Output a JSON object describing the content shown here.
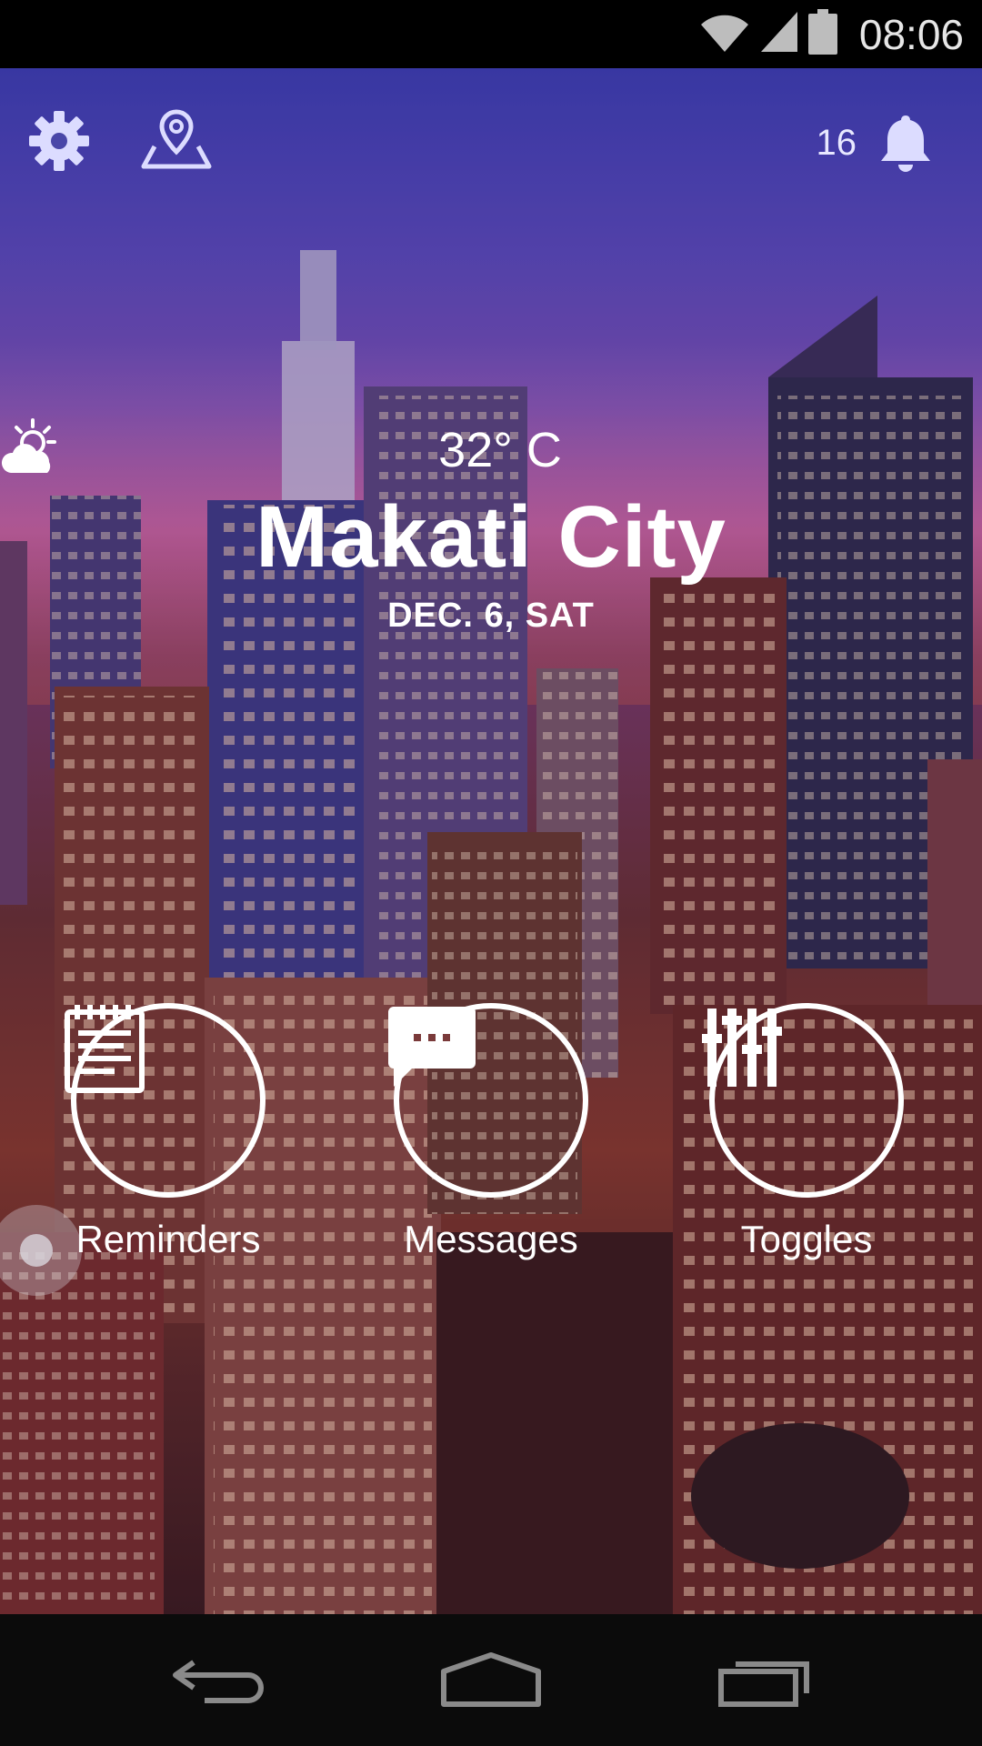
{
  "status_bar": {
    "time": "08:06",
    "icons": [
      "wifi-icon",
      "cell-signal-icon",
      "battery-icon"
    ]
  },
  "top_bar": {
    "settings_icon": "gear-icon",
    "location_icon": "map-pin-icon",
    "notification_count": "16",
    "notification_icon": "bell-icon"
  },
  "weather": {
    "icon": "partly-cloudy-icon",
    "temperature": "32° C",
    "city": "Makati City",
    "date": "DEC. 6, SAT"
  },
  "actions": [
    {
      "label": "Reminders",
      "icon": "notepad-icon"
    },
    {
      "label": "Messages",
      "icon": "chat-bubble-icon"
    },
    {
      "label": "Toggles",
      "icon": "sliders-icon"
    }
  ],
  "nav_bar": {
    "icons": [
      "back-icon",
      "home-icon",
      "recents-icon"
    ]
  },
  "colors": {
    "accent": "#ffffff",
    "sky_top": "#3b3fb8",
    "city_glow": "#b0569a"
  }
}
